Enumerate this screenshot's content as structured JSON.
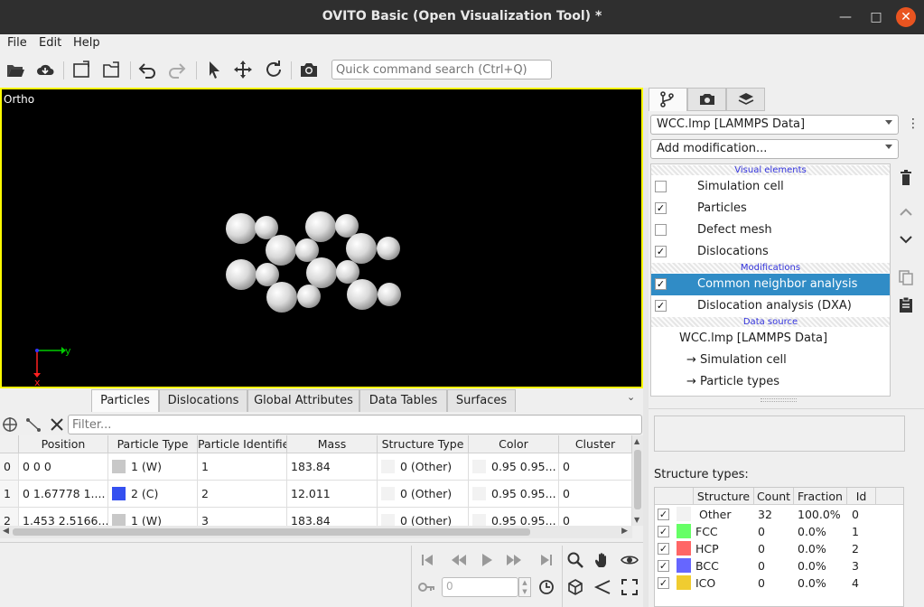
{
  "window": {
    "title": "OVITO Basic (Open Visualization Tool) *"
  },
  "menu": {
    "items": [
      "File",
      "Edit",
      "Help"
    ]
  },
  "toolbar": {
    "search_placeholder": "Quick command search (Ctrl+Q)"
  },
  "viewport": {
    "label": "Ortho",
    "axis_y": "y",
    "axis_x": "x"
  },
  "bottom_tabs": [
    "Particles",
    "Dislocations",
    "Global Attributes",
    "Data Tables",
    "Surfaces"
  ],
  "filter": {
    "placeholder": "Filter..."
  },
  "particles_table": {
    "columns": [
      "Position",
      "Particle Type",
      "Particle Identifier",
      "Mass",
      "Structure Type",
      "Color",
      "Cluster"
    ],
    "rows": [
      {
        "index": "0",
        "position": "0 0 0",
        "type": "1 (W)",
        "type_color": "#c8c8c8",
        "id": "1",
        "mass": "183.84",
        "structure": "0 (Other)",
        "color": "0.95 0.95...",
        "cluster": "0"
      },
      {
        "index": "1",
        "position": "0 1.67778 1....",
        "type": "2 (C)",
        "type_color": "#3450f0",
        "id": "2",
        "mass": "12.011",
        "structure": "0 (Other)",
        "color": "0.95 0.95...",
        "cluster": "0"
      },
      {
        "index": "2",
        "position": "1.453 2.5166...",
        "type": "1 (W)",
        "type_color": "#c8c8c8",
        "id": "3",
        "mass": "183.84",
        "structure": "0 (Other)",
        "color": "0.95 0.95...",
        "cluster": "0"
      }
    ]
  },
  "animation": {
    "frame_value": "0"
  },
  "pipeline": {
    "source_combo": "WCC.lmp [LAMMPS Data]",
    "add_modification": "Add modification...",
    "section_visual": "Visual elements",
    "section_mods": "Modifications",
    "section_source": "Data source",
    "visual_items": [
      {
        "label": "Simulation cell",
        "checked": false
      },
      {
        "label": "Particles",
        "checked": true
      },
      {
        "label": "Defect mesh",
        "checked": false
      },
      {
        "label": "Dislocations",
        "checked": true
      }
    ],
    "modifiers": [
      {
        "label": "Common neighbor analysis",
        "checked": true,
        "selected": true
      },
      {
        "label": "Dislocation analysis (DXA)",
        "checked": true,
        "selected": false
      }
    ],
    "source_items": [
      "WCC.lmp [LAMMPS Data]",
      "→ Simulation cell",
      "→ Particle types"
    ]
  },
  "structure_types": {
    "title": "Structure types:",
    "columns": [
      "Structure",
      "Count",
      "Fraction",
      "Id"
    ],
    "rows": [
      {
        "name": "Other",
        "count": "32",
        "fraction": "100.0%",
        "id": "0",
        "color": "#f2f2f2"
      },
      {
        "name": "FCC",
        "count": "0",
        "fraction": "0.0%",
        "id": "1",
        "color": "#66ff66"
      },
      {
        "name": "HCP",
        "count": "0",
        "fraction": "0.0%",
        "id": "2",
        "color": "#ff6666"
      },
      {
        "name": "BCC",
        "count": "0",
        "fraction": "0.0%",
        "id": "3",
        "color": "#6666ff"
      },
      {
        "name": "ICO",
        "count": "0",
        "fraction": "0.0%",
        "id": "4",
        "color": "#f0cc30"
      }
    ]
  }
}
